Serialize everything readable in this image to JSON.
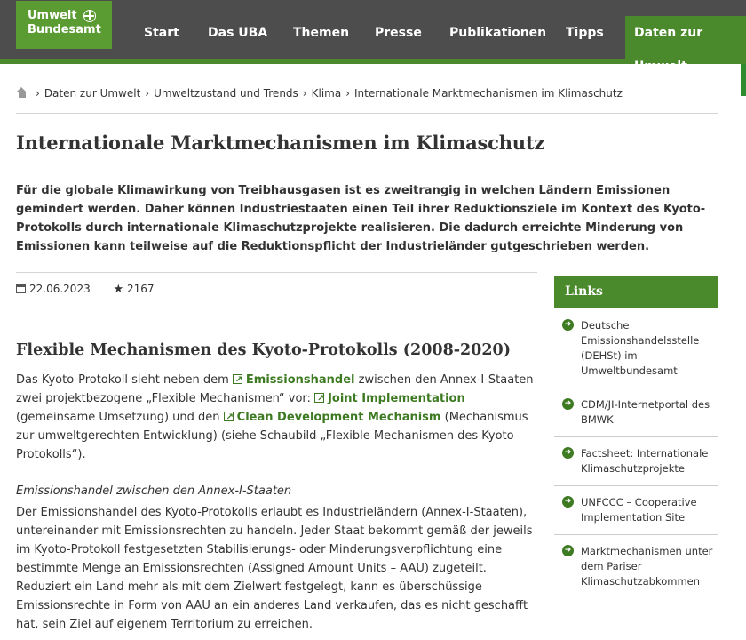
{
  "header": {
    "logo_line1": "Umwelt",
    "logo_line2": "Bundesamt",
    "nav": [
      "Start",
      "Das UBA",
      "Themen",
      "Presse",
      "Publikationen",
      "Tipps",
      "Daten zur Umwelt"
    ]
  },
  "breadcrumb": [
    "Daten zur Umwelt",
    "Umweltzustand und Trends",
    "Klima",
    "Internationale Marktmechanismen im Klimaschutz"
  ],
  "page_title": "Internationale Marktmechanismen im Klimaschutz",
  "lead": "Für die globale Klimawirkung von Treibhausgasen ist es zweitrangig in welchen Ländern Emissionen gemindert werden. Daher können Industriestaaten einen Teil ihrer Reduktionsziele im Kontext des Kyoto-Protokolls durch internationale Klimaschutzprojekte realisieren. Die dadurch erreichte Minderung von Emissionen kann teilweise auf die Reduktionspflicht der Industrieländer gutgeschrieben werden.",
  "meta": {
    "date": "22.06.2023",
    "rating": "2167"
  },
  "section": {
    "title": "Flexible Mechanismen des Kyoto-Protokolls (2008-2020)",
    "p1_a": "Das Kyoto-Protokoll sieht neben dem ",
    "link1": "Emissionshandel",
    "p1_b": " zwischen den Annex-I-Staaten zwei projektbezogene „Flexible Mechanismen“ vor: ",
    "link2": "Joint Implementation",
    "p1_c": " (gemeinsame Umsetzung) und den ",
    "link3": "Clean Development Mechanism",
    "p1_d": " (Mechanismus zur umweltgerechten Entwicklung) (siehe Schaubild „Flexible Mechanismen des Kyoto Protokolls“).",
    "subheading": "Emissionshandel zwischen den Annex-I-Staaten",
    "p2": "Der Emissionshandel des Kyoto-Protokolls erlaubt es Industrieländern (Annex-I-Staaten), untereinander mit Emissionsrechten zu handeln. Jeder Staat bekommt gemäß der jeweils im Kyoto-Protokoll festgesetzten Stabilisierungs- oder Minderungsverpflichtung eine bestimmte Menge an Emissionsrechten (Assigned Amount Units – AAU) zugeteilt. Reduziert ein Land mehr als mit dem Zielwert festgelegt, kann es überschüssige Emissionsrechte in Form von AAU an ein anderes Land verkaufen, das es nicht geschafft hat, sein Ziel auf eigenem Territorium zu erreichen."
  },
  "sidebar": {
    "title": "Links",
    "items": [
      "Deutsche Emissionshandelsstelle (DEHSt) im Umweltbundesamt",
      "CDM/JI-Internetportal des BMWK",
      "Factsheet: Internationale Klimaschutzprojekte",
      "UNFCCC – Cooperative Implementation Site",
      "Marktmechanismen unter dem Pariser Klimaschutzabkommen"
    ]
  },
  "colors": {
    "brand_green": "#4a8a2c",
    "header_gray": "#4d4d4d",
    "link_green": "#3d7a22"
  }
}
